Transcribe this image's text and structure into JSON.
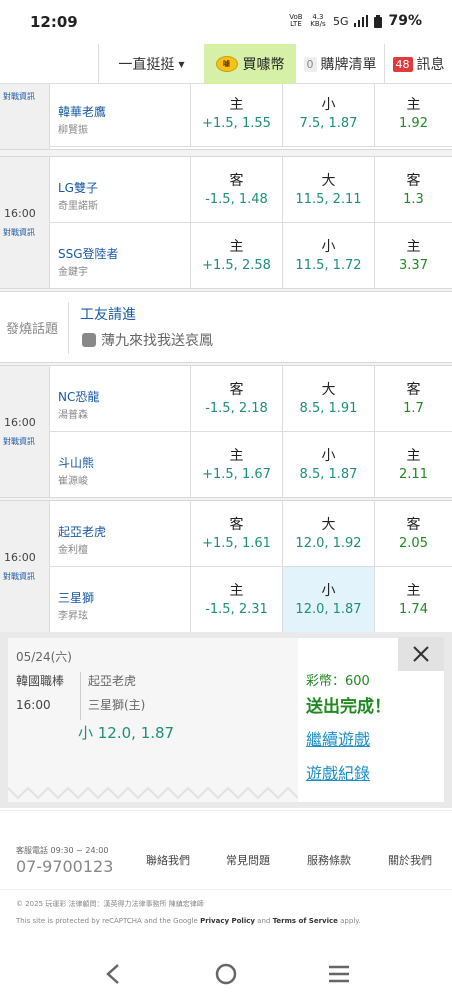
{
  "status": {
    "time": "12:09",
    "volte": "VoB LTE",
    "speed_top": "4.3",
    "speed_unit": "KB/s",
    "network": "5G",
    "battery": "79%"
  },
  "nav": {
    "dropdown": "一直挺挺",
    "buy_label": "買噱幣",
    "coin_text": "噱",
    "cart_count": "0",
    "cart_label": "購牌清單",
    "msg_count": "48",
    "msg_label": "訊息"
  },
  "game0": {
    "tag": "對戰資訊",
    "team2": {
      "name": "韓華老鷹",
      "pitcher": "柳賢振",
      "h_label": "主",
      "h_odds": "+1.5, 1.55",
      "t_label": "小",
      "t_odds": "7.5, 1.87",
      "m_label": "主",
      "m_odds": "1.92"
    }
  },
  "game1": {
    "time": "16:00",
    "tag": "對戰資訊",
    "team1": {
      "name": "LG雙子",
      "pitcher": "奇里諾斯",
      "h_label": "客",
      "h_odds": "-1.5, 1.48",
      "t_label": "大",
      "t_odds": "11.5, 2.11",
      "m_label": "客",
      "m_odds": "1.3"
    },
    "team2": {
      "name": "SSG登陸者",
      "pitcher": "金鍵宇",
      "h_label": "主",
      "h_odds": "+1.5, 2.58",
      "t_label": "小",
      "t_odds": "11.5, 1.72",
      "m_label": "主",
      "m_odds": "3.37"
    }
  },
  "topic": {
    "label": "發燒話題",
    "title": "工友請進",
    "subtitle": "薄九來找我送哀鳳"
  },
  "game2": {
    "time": "16:00",
    "tag": "對戰資訊",
    "team1": {
      "name": "NC恐龍",
      "pitcher": "湯普森",
      "h_label": "客",
      "h_odds": "-1.5, 2.18",
      "t_label": "大",
      "t_odds": "8.5, 1.91",
      "m_label": "客",
      "m_odds": "1.7"
    },
    "team2": {
      "name": "斗山熊",
      "pitcher": "崔源峻",
      "h_label": "主",
      "h_odds": "+1.5, 1.67",
      "t_label": "小",
      "t_odds": "8.5, 1.87",
      "m_label": "主",
      "m_odds": "2.11"
    }
  },
  "game3": {
    "time": "16:00",
    "tag": "對戰資訊",
    "team1": {
      "name": "起亞老虎",
      "pitcher": "金利檀",
      "h_label": "客",
      "h_odds": "+1.5, 1.61",
      "t_label": "大",
      "t_odds": "12.0, 1.92",
      "m_label": "客",
      "m_odds": "2.05"
    },
    "team2": {
      "name": "三星獅",
      "pitcher": "李昇玹",
      "h_label": "主",
      "h_odds": "-1.5, 2.31",
      "t_label": "小",
      "t_odds": "12.0, 1.87",
      "m_label": "主",
      "m_odds": "1.74"
    }
  },
  "slip": {
    "date": "05/24(六)",
    "league": "韓國職棒",
    "time": "16:00",
    "away": "起亞老虎",
    "home": "三星獅(主)",
    "bet": "小 12.0, 1.87",
    "coins": "彩幣：600",
    "done": "送出完成！",
    "continue": "繼續遊戲",
    "record": "遊戲紀錄"
  },
  "footer": {
    "hotline_label": "客服電話 09:30 ~ 24:00",
    "phone": "07-9700123",
    "links": [
      "聯絡我們",
      "常見問題",
      "服務條款",
      "關於我們"
    ],
    "copyright": "© 2025 玩運彩 法律顧問：漢英得力法律事務所 陳鎮宏律師",
    "recaptcha_pre": "This site is protected by reCAPTCHA and the Google ",
    "privacy": "Privacy Policy",
    "and": " and ",
    "terms": "Terms of Service",
    "apply": " apply."
  }
}
